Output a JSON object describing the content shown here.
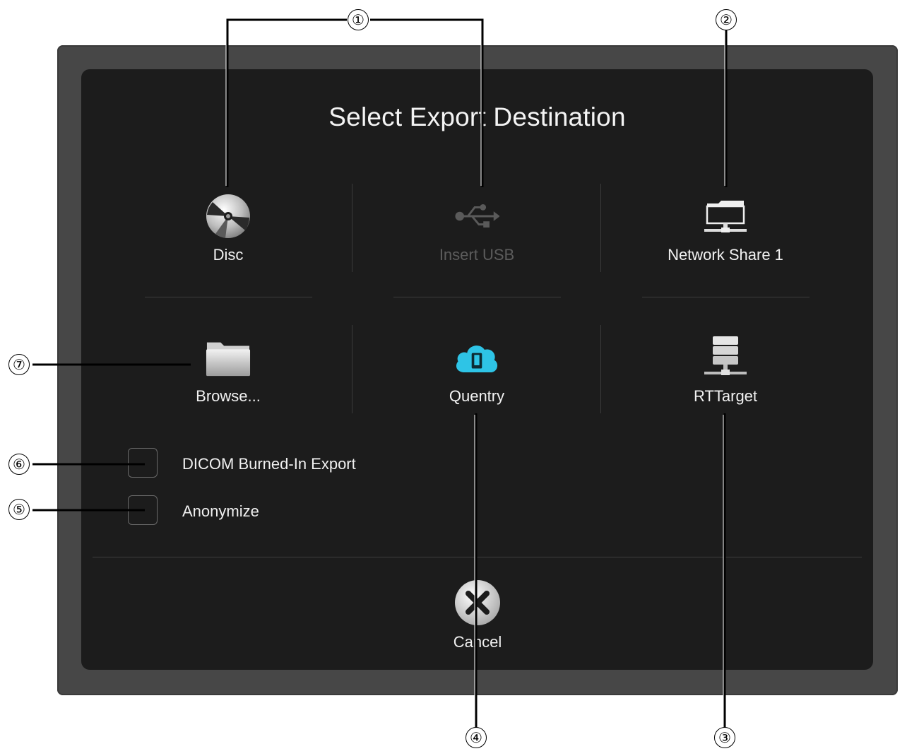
{
  "dialog": {
    "title": "Select Export Destination"
  },
  "options": {
    "disc": {
      "label": "Disc",
      "icon": "disc-icon"
    },
    "usb": {
      "label": "Insert USB",
      "icon": "usb-icon",
      "enabled": false
    },
    "network": {
      "label": "Network Share 1",
      "icon": "network-folder-icon"
    },
    "browse": {
      "label": "Browse...",
      "icon": "folder-icon"
    },
    "quentry": {
      "label": "Quentry",
      "icon": "cloud-icon"
    },
    "rttarget": {
      "label": "RTTarget",
      "icon": "server-icon"
    }
  },
  "checkboxes": {
    "dicom_burned_in": {
      "label": "DICOM Burned-In Export",
      "checked": false
    },
    "anonymize": {
      "label": "Anonymize",
      "checked": false
    }
  },
  "cancel": {
    "label": "Cancel",
    "icon": "close-icon"
  },
  "callouts": {
    "c1": "①",
    "c2": "②",
    "c3": "③",
    "c4": "④",
    "c5": "⑤",
    "c6": "⑥",
    "c7": "⑦"
  },
  "colors": {
    "dialog_bg": "#1c1c1c",
    "frame_bg": "#474747",
    "quentry_accent": "#2ec4e6",
    "disabled_text": "#5c5c5c"
  }
}
